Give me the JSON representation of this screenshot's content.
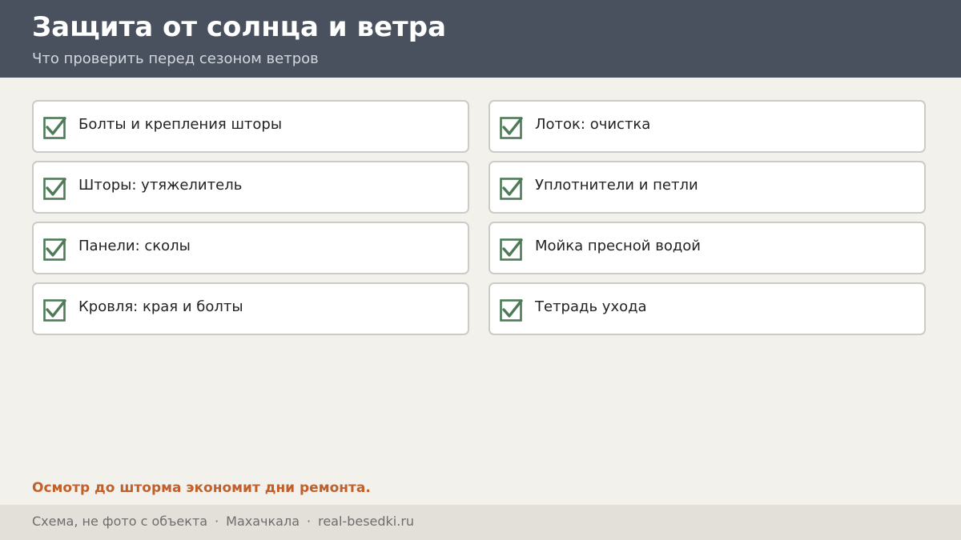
{
  "header": {
    "title": "Защита от солнца и ветра",
    "subtitle": "Что проверить перед сезоном ветров"
  },
  "checklist": {
    "check_icon": "checkbox-checked-icon",
    "check_color": "#4d7a57",
    "items": [
      {
        "label": "Болты и крепления шторы",
        "checked": true
      },
      {
        "label": "Лоток: очистка",
        "checked": true
      },
      {
        "label": "Шторы: утяжелитель",
        "checked": true
      },
      {
        "label": "Уплотнители и петли",
        "checked": true
      },
      {
        "label": "Панели: сколы",
        "checked": true
      },
      {
        "label": "Мойка пресной водой",
        "checked": true
      },
      {
        "label": "Кровля: края и болты",
        "checked": true
      },
      {
        "label": "Тетрадь ухода",
        "checked": true
      }
    ]
  },
  "tagline": "Осмотр до шторма экономит дни ремонта.",
  "footer": {
    "note": "Схема, не фото с объекта",
    "separator": "·",
    "city": "Махачкала",
    "site": "real-besedki.ru"
  },
  "colors": {
    "header_bg": "#48515d",
    "page_bg": "#f3f1ec",
    "accent": "#c0602c",
    "check": "#4d7a57"
  }
}
